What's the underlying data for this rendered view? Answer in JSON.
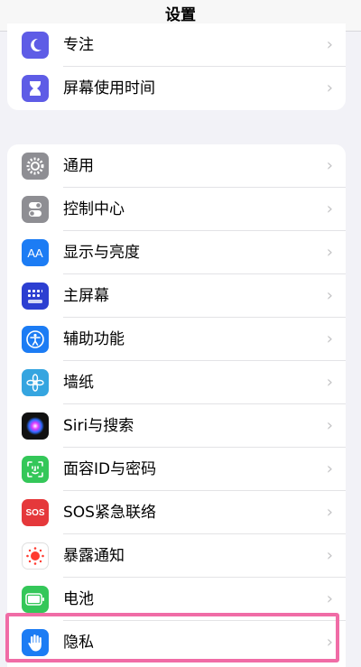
{
  "navbar": {
    "title": "设置"
  },
  "group1": [
    {
      "label": "专注",
      "icon": "moon-icon",
      "color": "#5e5ce6"
    },
    {
      "label": "屏幕使用时间",
      "icon": "hourglass-icon",
      "color": "#5e5ce6"
    }
  ],
  "group2": [
    {
      "label": "通用",
      "icon": "gear-icon",
      "color": "#8e8e93"
    },
    {
      "label": "控制中心",
      "icon": "toggles-icon",
      "color": "#8e8e93"
    },
    {
      "label": "显示与亮度",
      "icon": "text-size-icon",
      "color": "#1c7cf4"
    },
    {
      "label": "主屏幕",
      "icon": "home-grid-icon",
      "color": "#2c3fd1"
    },
    {
      "label": "辅助功能",
      "icon": "accessibility-icon",
      "color": "#1c7cf4"
    },
    {
      "label": "墙纸",
      "icon": "flower-icon",
      "color": "#35a5e0"
    },
    {
      "label": "Siri与搜索",
      "icon": "siri-icon",
      "color": "#111111"
    },
    {
      "label": "面容ID与密码",
      "icon": "face-id-icon",
      "color": "#34c759"
    },
    {
      "label": "SOS紧急联络",
      "icon": "sos-icon",
      "color": "#e5383b"
    },
    {
      "label": "暴露通知",
      "icon": "exposure-icon",
      "color": "#ffffff"
    },
    {
      "label": "电池",
      "icon": "battery-icon",
      "color": "#34c759"
    },
    {
      "label": "隐私",
      "icon": "hand-icon",
      "color": "#1c7cf4"
    }
  ],
  "sos_icon_text": "SOS",
  "text_size_icon_text": "AA",
  "highlight_color": "#f06ca6"
}
